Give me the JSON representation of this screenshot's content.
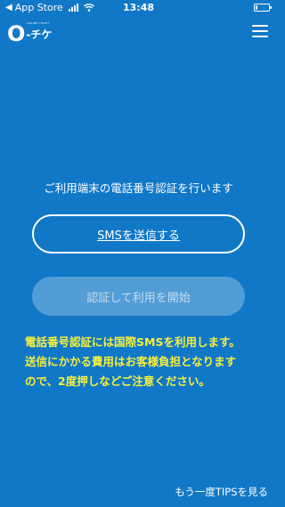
{
  "status_bar": {
    "back_label": "App Store",
    "time": "13:48",
    "battery_level": 0.15
  },
  "header": {
    "logo_letter": "O",
    "logo_kana": "-チケ",
    "logo_tagline": "ONLINE TICKET",
    "menu_icon": "hamburger-icon"
  },
  "main": {
    "instruction": "ご利用端末の電話番号認証を行います",
    "sms_button_label": "SMSを送信する",
    "auth_button_label": "認証して利用を開始",
    "notice_lines": [
      "電話番号認証には国際SMSを利用します。",
      "送信にかかる費用はお客様負担となります",
      "ので、2度押しなどご注意ください。"
    ]
  },
  "footer": {
    "tips_link_label": "もう一度TIPSを見る"
  },
  "colors": {
    "background": "#1178C8",
    "notice": "#F7F03C",
    "text": "#FFFFFF"
  }
}
